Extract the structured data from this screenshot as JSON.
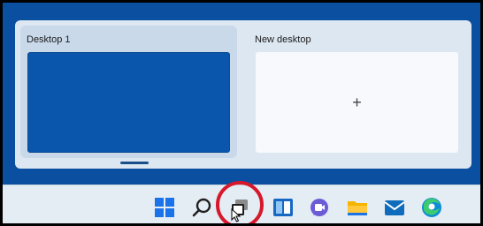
{
  "task_view": {
    "desktops": [
      {
        "label": "Desktop 1",
        "active": true
      },
      {
        "label": "New desktop",
        "icon": "plus-icon",
        "symbol": "+"
      }
    ]
  },
  "taskbar": {
    "icons": [
      "windows-start-icon",
      "search-icon",
      "task-view-icon",
      "widgets-icon",
      "teams-chat-icon",
      "file-explorer-icon",
      "mail-icon",
      "edge-browser-icon"
    ],
    "highlighted": "task-view-icon"
  },
  "colors": {
    "desktop_background": "#0a4fa0",
    "active_desktop_thumbnail": "#0a56ad",
    "task_view_panel": "#dce7f2",
    "taskbar": "#e4ecf4",
    "highlight_ring": "#d7182a"
  }
}
